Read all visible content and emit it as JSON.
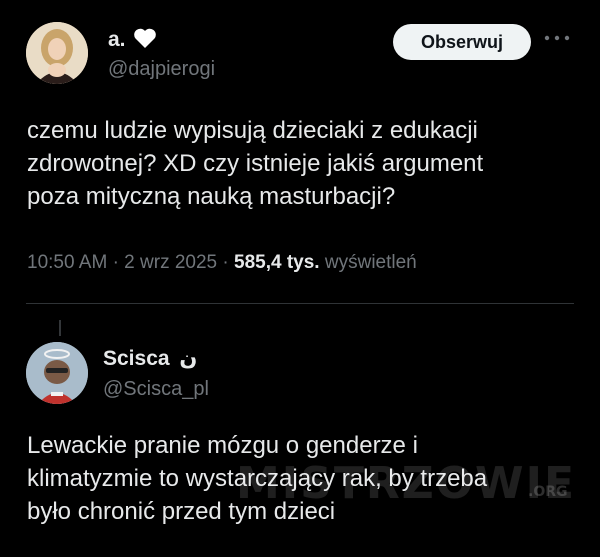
{
  "tweet1": {
    "name": "a.",
    "name_suffix_icon": "white-heart-icon",
    "handle": "@dajpierogi",
    "follow_label": "Obserwuj",
    "more_icon": "more-options-icon",
    "text_lines": [
      "czemu ludzie wypisują dzieciaki z edukacji",
      "zdrowotnej? XD czy istnieje jakiś argument",
      "poza mityczną nauką masturbacji?"
    ],
    "time": "10:50 AM",
    "date": "2 wrz 2025",
    "views_count": "585,4 tys.",
    "views_label": "wyświetleń"
  },
  "tweet2": {
    "name": "Scisca",
    "name_suffix": "ن",
    "handle": "@Scisca_pl",
    "text_lines": [
      "Lewackie pranie mózgu o genderze i",
      "klimatyzmie to wystarczający rak, by trzeba",
      "było chronić przed tym dzieci"
    ]
  },
  "watermark": {
    "text": "MISTRZOWIE",
    "suffix": ".ORG"
  }
}
